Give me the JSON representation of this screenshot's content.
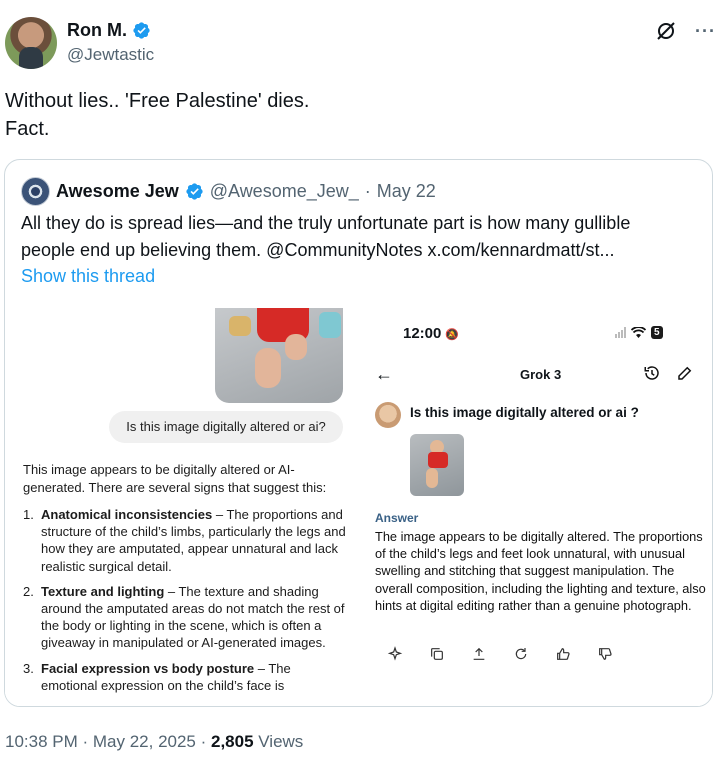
{
  "author": {
    "display_name": "Ron M.",
    "handle": "@Jewtastic",
    "verified_color": "#1d9bf0"
  },
  "tweet": {
    "lines": [
      "Without lies.. 'Free Palestine' dies.",
      "Fact."
    ]
  },
  "header_actions": {
    "grok_icon": "grok-slash-icon",
    "more_label": "···"
  },
  "quote": {
    "display_name": "Awesome Jew",
    "handle": "@Awesome_Jew_",
    "separator": "·",
    "date": "May 22",
    "text_line1": "All they do is spread lies—and the truly unfortunate part is how many gullible",
    "text_line2": "people end up believing them. @CommunityNotes x.com/kennardmatt/st...",
    "show_thread": "Show this thread"
  },
  "left_screenshot": {
    "prompt": "Is this image digitally altered or ai?",
    "intro": "This image appears to be digitally altered or AI-generated. There are several signs that suggest this:",
    "items": [
      {
        "num": "1.",
        "title": "Anatomical inconsistencies",
        "body": " – The proportions and structure of the child’s limbs, particularly the legs and how they are amputated, appear unnatural and lack realistic surgical detail."
      },
      {
        "num": "2.",
        "title": "Texture and lighting",
        "body": " – The texture and shading around the amputated areas do not match the rest of the body or lighting in the scene, which is often a giveaway in manipulated or AI-generated images."
      },
      {
        "num": "3.",
        "title": "Facial expression vs body posture",
        "body": " – The emotional expression on the child’s face is"
      }
    ]
  },
  "right_screenshot": {
    "status_time": "12:00",
    "battery": "5",
    "title": "Grok 3",
    "question": "Is this image digitally altered or ai ?",
    "answer_label": "Answer",
    "answer": "The image appears to be digitally altered. The proportions of the child’s legs and feet look unnatural, with unusual swelling and stitching that suggest manipulation. The overall composition, including the lighting and texture, also hints at digital editing rather than a genuine photograph."
  },
  "meta": {
    "time": "10:38 PM",
    "sep": " · ",
    "date": "May 22, 2025",
    "views_count": "2,805",
    "views_label": " Views"
  }
}
